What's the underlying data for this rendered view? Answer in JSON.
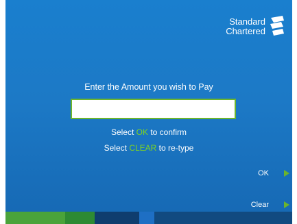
{
  "brand": {
    "line1": "Standard",
    "line2": "Chartered"
  },
  "main": {
    "prompt": "Enter the Amount you wish to Pay",
    "amount_value": "",
    "hint1_pre": "Select ",
    "hint1_kw": "OK",
    "hint1_post": " to confirm",
    "hint2_pre": "Select ",
    "hint2_kw": "CLEAR",
    "hint2_post": " to re-type"
  },
  "buttons": {
    "ok_label": "OK",
    "clear_label": "Clear"
  },
  "colors": {
    "background": "#1a7fce",
    "accent_green": "#6bb42c",
    "keyword_green": "#7ed321"
  }
}
